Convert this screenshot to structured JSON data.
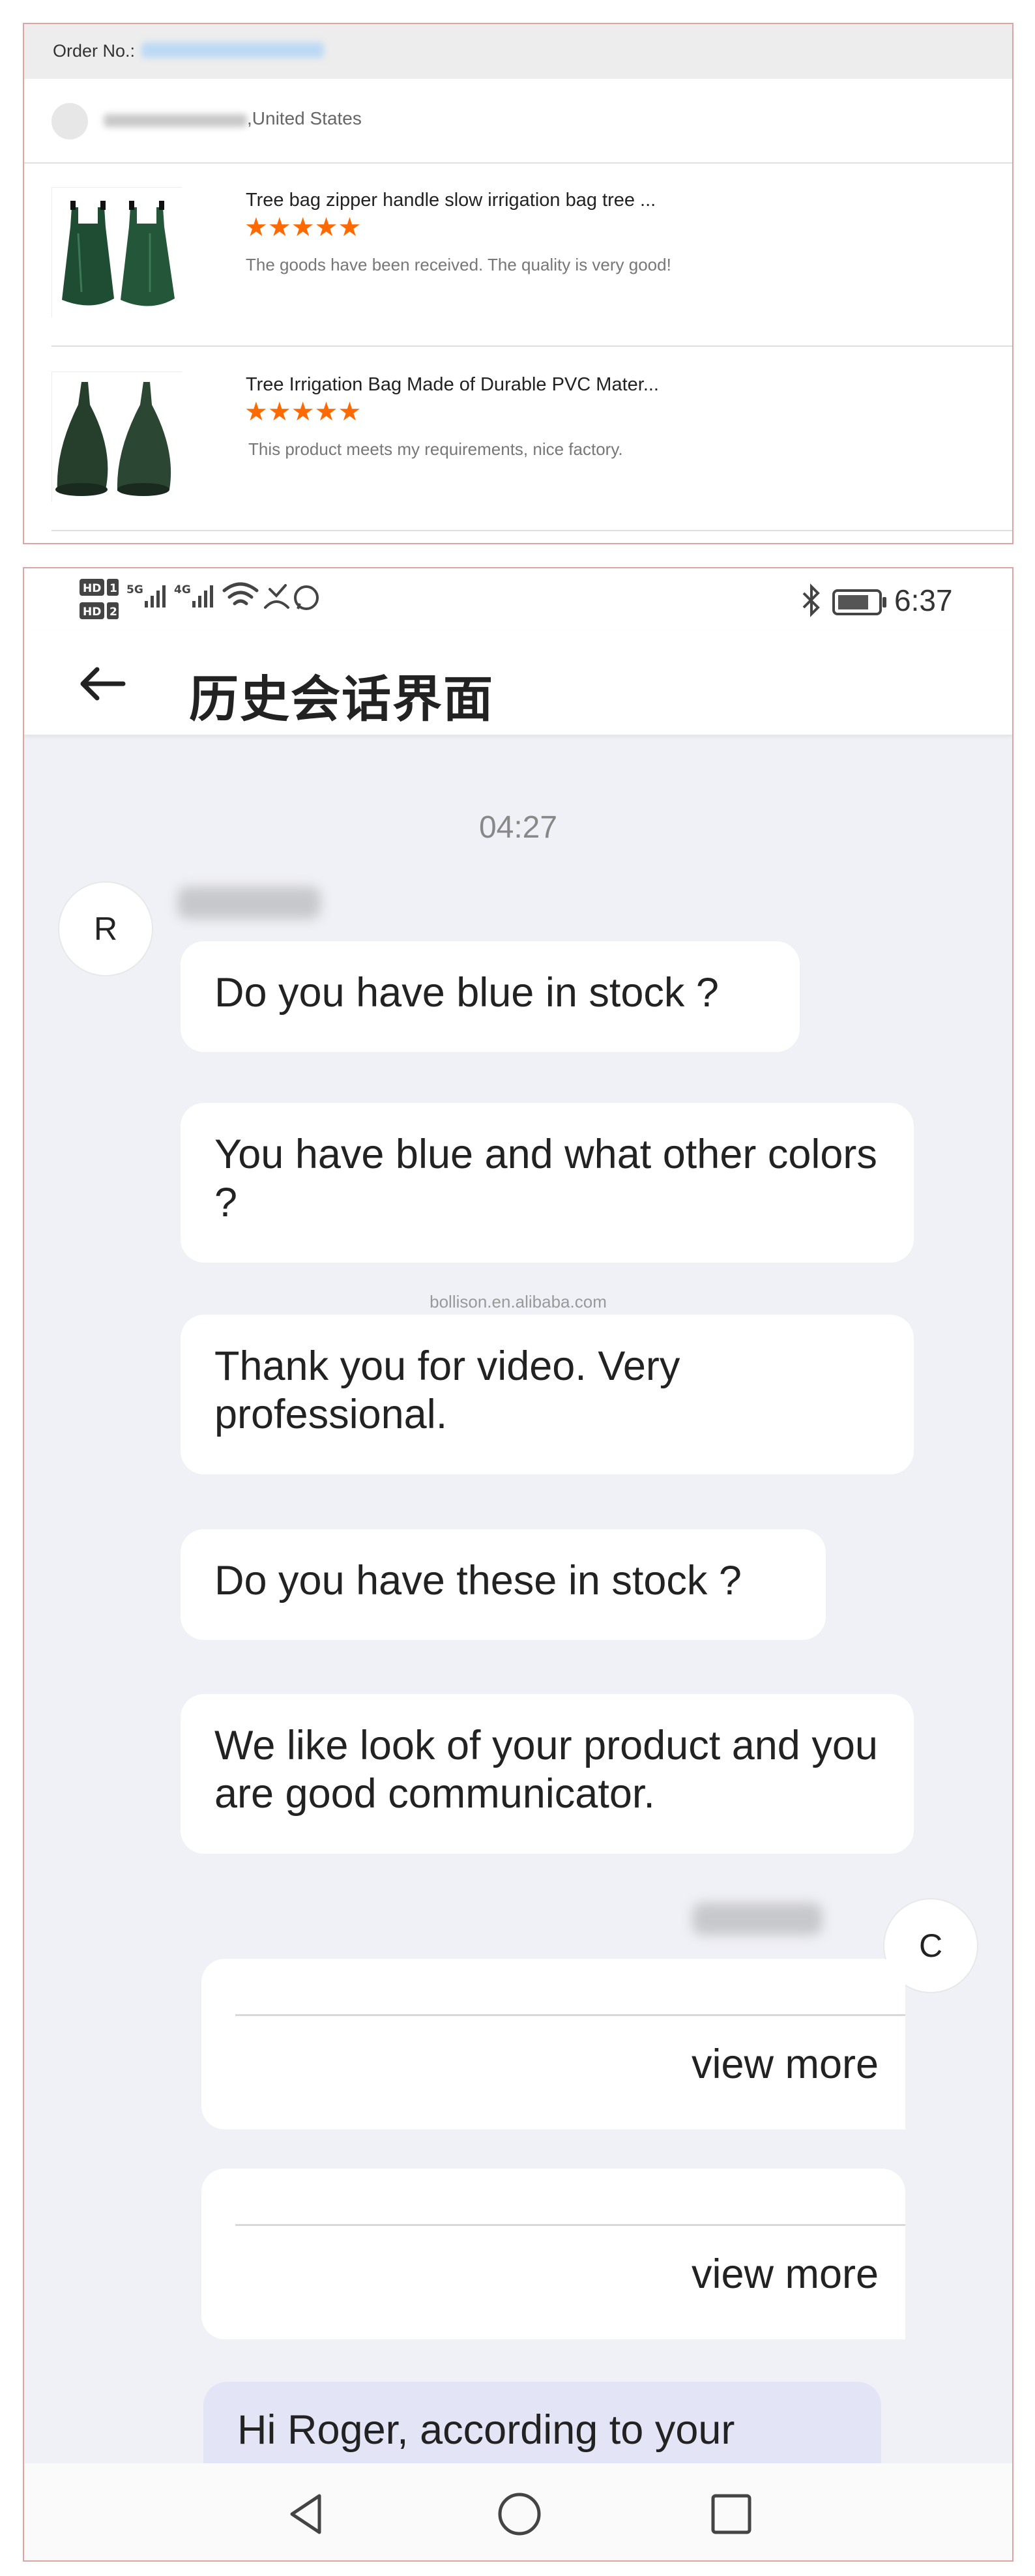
{
  "order_card": {
    "order_no_label": "Order No.:",
    "buyer_location": ",United States",
    "products": [
      {
        "title": "Tree bag zipper handle slow irrigation bag tree ...",
        "rating": 5,
        "stars": "★★★★★",
        "review": "The goods have been received. The quality is very good!"
      },
      {
        "title": "Tree Irrigation Bag Made of Durable PVC Mater...",
        "rating": 5,
        "stars": "★★★★★",
        "review": "This product meets my requirements, nice factory."
      }
    ]
  },
  "phone": {
    "status_bar": {
      "time": "6:37",
      "left_icons": [
        "hd1-hd2-icon",
        "5g-signal-icon",
        "4g-signal-icon",
        "wifi-icon",
        "missed-call-icon",
        "whatsapp-icon"
      ],
      "right_icons": [
        "bluetooth-icon",
        "battery-icon"
      ]
    },
    "nav": {
      "title": "历史会话界面"
    },
    "chat": {
      "timestamp": "04:27",
      "avatar_left_initial": "R",
      "avatar_right_initial": "C",
      "watermark": "bollison.en.alibaba.com",
      "messages_left": [
        "Do you have blue in stock ?",
        "You have blue and what other colors ?",
        "Thank you for video. Very professional.",
        "Do you have these in stock ?",
        "We like look of your product and you are good communicator."
      ],
      "cards_right": [
        {
          "link": "view more"
        },
        {
          "link": "view more"
        }
      ],
      "message_right_partial": "Hi Roger, according to your"
    },
    "bottom_nav": [
      "back-triangle-icon",
      "home-circle-icon",
      "recents-square-icon"
    ]
  },
  "colors": {
    "star": "#ff6a00",
    "chat_background": "#f0f1f6",
    "outgoing_bubble": "#e3e5f7",
    "frame_border": "#dca4a4"
  }
}
